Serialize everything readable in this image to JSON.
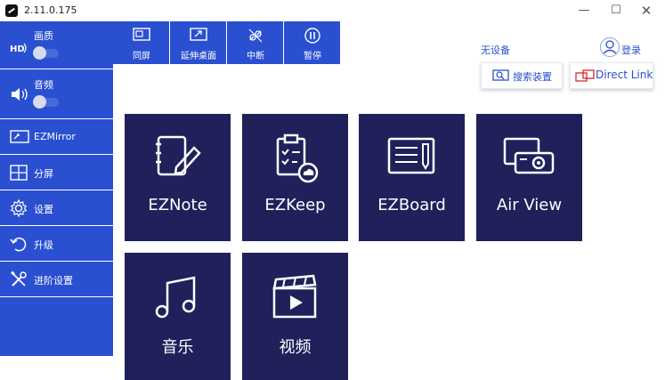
{
  "window": {
    "version": "2.11.0.175"
  },
  "window_controls": {
    "minimize": "—",
    "maximize": "☐",
    "close": "✕"
  },
  "sidebar": {
    "items": [
      {
        "label": "画质",
        "icon": "hd-icon",
        "toggle_on": false
      },
      {
        "label": "音频",
        "icon": "speaker-icon",
        "toggle_on": false
      },
      {
        "label": "EZMirror",
        "icon": "mirror-icon"
      },
      {
        "label": "分屏",
        "icon": "split-screen-icon"
      },
      {
        "label": "设置",
        "icon": "gear-icon"
      },
      {
        "label": "升级",
        "icon": "upgrade-icon"
      },
      {
        "label": "进阶设置",
        "icon": "tools-icon"
      }
    ]
  },
  "toolbar": {
    "buttons": [
      {
        "label": "同屏",
        "icon": "mirror-screen-icon"
      },
      {
        "label": "延伸桌面",
        "icon": "extend-desktop-icon"
      },
      {
        "label": "中断",
        "icon": "disconnect-icon"
      },
      {
        "label": "暂停",
        "icon": "pause-icon"
      }
    ]
  },
  "status": {
    "device": "无设备"
  },
  "login": {
    "label": "登录"
  },
  "actions": {
    "search": "搜索装置",
    "direct_link": "Direct Link"
  },
  "apps": [
    {
      "label": "EZNote",
      "icon": "note-icon"
    },
    {
      "label": "EZKeep",
      "icon": "clipboard-cloud-icon"
    },
    {
      "label": "EZBoard",
      "icon": "board-icon"
    },
    {
      "label": "Air View",
      "icon": "projector-icon"
    },
    {
      "label": "音乐",
      "icon": "music-icon"
    },
    {
      "label": "视频",
      "icon": "video-icon"
    }
  ],
  "colors": {
    "sidebar": "#2a4fd0",
    "tile": "#20215a",
    "accent": "#2a4fd0",
    "direct_link_icon": "#d8262c"
  }
}
